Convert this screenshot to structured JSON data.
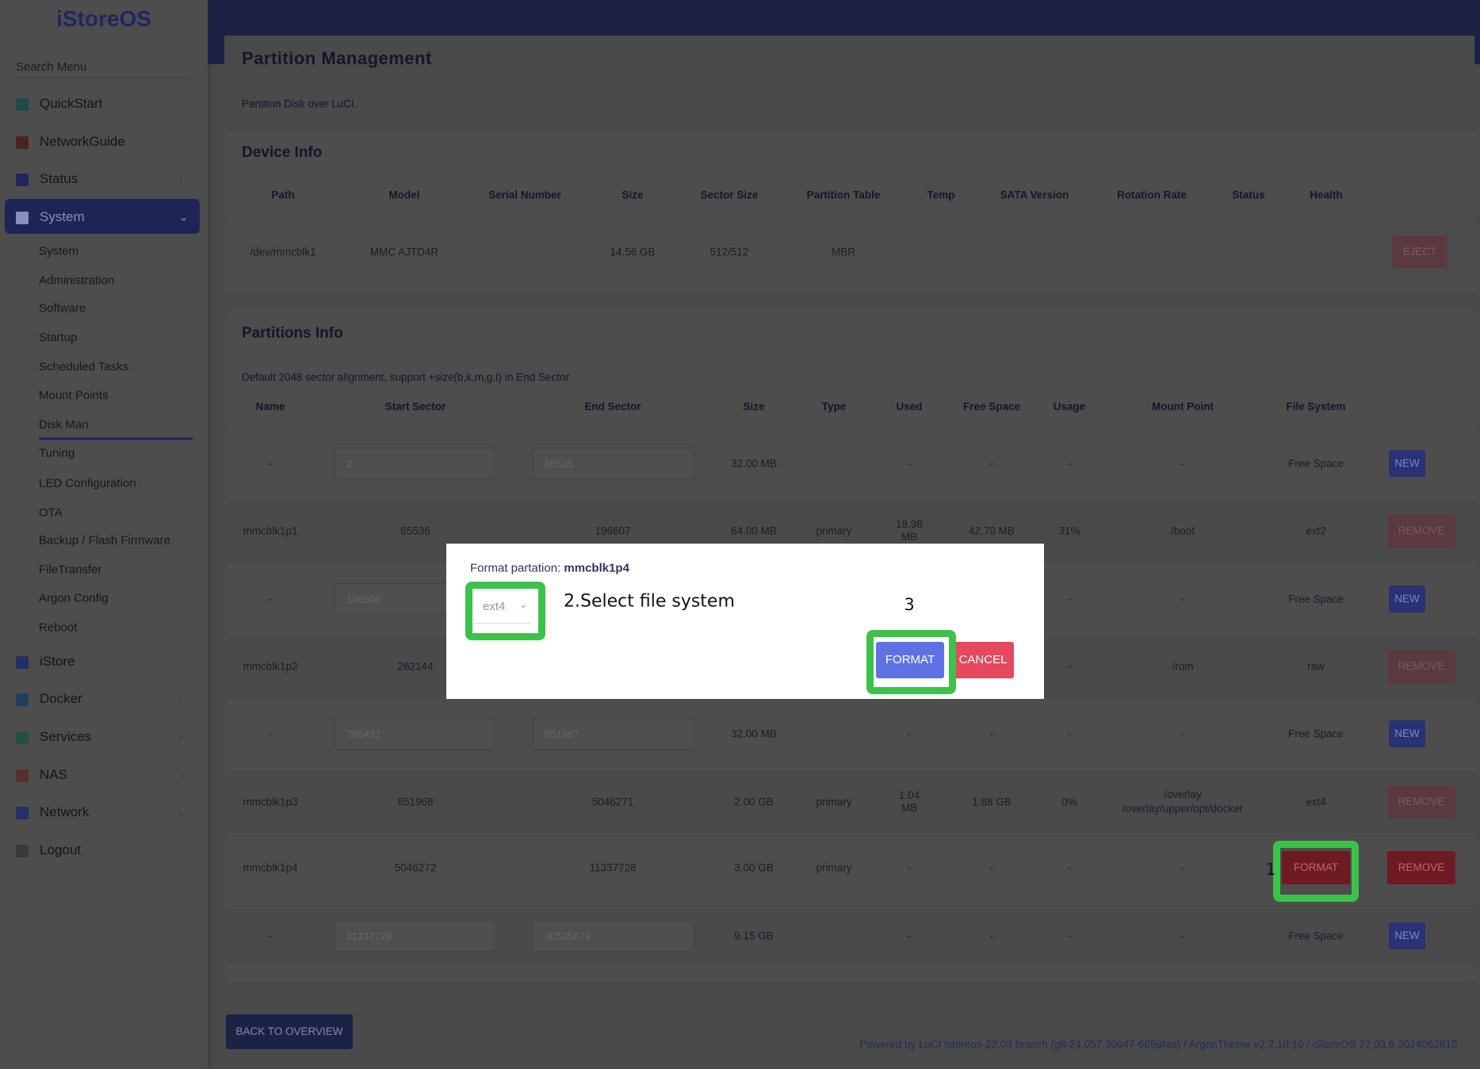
{
  "sidebar": {
    "logo": "iStoreOS",
    "search_placeholder": "Search Menu",
    "items": [
      {
        "label": "QuickStart",
        "icon": "quickstart-icon"
      },
      {
        "label": "NetworkGuide",
        "icon": "globe-icon"
      },
      {
        "label": "Status",
        "icon": "dashboard-icon"
      },
      {
        "label": "System",
        "icon": "gear-icon"
      }
    ],
    "system_sub": [
      "System",
      "Administration",
      "Software",
      "Startup",
      "Scheduled Tasks",
      "Mount Points",
      "Disk Man",
      "Tuning",
      "LED Configuration",
      "OTA",
      "Backup / Flash Firmware",
      "FileTransfer",
      "Argon Config",
      "Reboot"
    ],
    "active_sub": "Disk Man",
    "bottom_items": [
      {
        "label": "iStore",
        "icon": "store-icon"
      },
      {
        "label": "Docker",
        "icon": "docker-icon"
      },
      {
        "label": "Services",
        "icon": "services-icon"
      },
      {
        "label": "NAS",
        "icon": "nas-icon"
      },
      {
        "label": "Network",
        "icon": "network-icon"
      },
      {
        "label": "Logout",
        "icon": "logout-icon"
      }
    ]
  },
  "page": {
    "title": "Partition Management",
    "description": "Partition Disk over LuCI."
  },
  "device_info": {
    "heading": "Device Info",
    "headers": [
      "Path",
      "Model",
      "Serial Number",
      "Size",
      "Sector Size",
      "Partition Table",
      "Temp",
      "SATA Version",
      "Rotation Rate",
      "Status",
      "Health"
    ],
    "row": [
      "/dev/mmcblk1",
      "MMC AJTD4R",
      "",
      "14.56 GB",
      "512/512",
      "MBR",
      "",
      "",
      "",
      "",
      ""
    ],
    "eject_label": "EJECT"
  },
  "partitions": {
    "heading": "Partitions Info",
    "note": "Default 2048 sector alignment, support +size(b,k,m,g,t) in End Sector",
    "headers": [
      "Name",
      "Start Sector",
      "End Sector",
      "Size",
      "Type",
      "Used",
      "Free Space",
      "Usage",
      "Mount Point",
      "File System"
    ],
    "rows": [
      {
        "name": "-",
        "start": "2",
        "end": "65535",
        "size": "32.00 MB",
        "type": "",
        "used": "-",
        "free": "-",
        "usage": "-",
        "mount": "-",
        "fs": "Free Space",
        "action": "NEW",
        "editable": true
      },
      {
        "name": "mmcblk1p1",
        "start": "65536",
        "end": "196607",
        "size": "64.00 MB",
        "type": "primary",
        "used": "18.98 MB",
        "free": "42.70 MB",
        "usage": "31%",
        "mount": "/boot",
        "fs": "ext2",
        "action": "REMOVE"
      },
      {
        "name": "-",
        "start": "196608",
        "end": "",
        "size": "",
        "type": "",
        "used": "",
        "free": "",
        "usage": "-",
        "mount": "-",
        "fs": "Free Space",
        "action": "NEW",
        "editable": true
      },
      {
        "name": "mmcblk1p2",
        "start": "262144",
        "end": "",
        "size": "",
        "type": "",
        "used": "",
        "free": "",
        "usage": "-",
        "mount": "/rom",
        "fs": "raw",
        "action": "REMOVE"
      },
      {
        "name": "-",
        "start": "786432",
        "end": "851967",
        "size": "32.00 MB",
        "type": "",
        "used": "-",
        "free": "-",
        "usage": "-",
        "mount": "-",
        "fs": "Free Space",
        "action": "NEW",
        "editable": true
      },
      {
        "name": "mmcblk1p3",
        "start": "851968",
        "end": "5046271",
        "size": "2.00 GB",
        "type": "primary",
        "used": "1.04 MB",
        "free": "1.88 GB",
        "usage": "0%",
        "mount": "/overlay\n/overlay/upper/opt/docker",
        "fs": "ext4",
        "action": "REMOVE"
      },
      {
        "name": "mmcblk1p4",
        "start": "5046272",
        "end": "11337728",
        "size": "3.00 GB",
        "type": "primary",
        "used": "-",
        "free": "-",
        "usage": "-",
        "mount": "-",
        "fs": "FORMAT",
        "action": "REMOVE",
        "active": true
      },
      {
        "name": "-",
        "start": "11337729",
        "end": "30535679",
        "size": "9.15 GB",
        "type": "",
        "used": "-",
        "free": "-",
        "usage": "-",
        "mount": "-",
        "fs": "Free Space",
        "action": "NEW",
        "editable": true
      }
    ]
  },
  "back_label": "BACK TO OVERVIEW",
  "footer": "Powered by LuCI istoreos-22.03 branch (git-24.057.30647-6659faa) / ArgonTheme v2.2.10.10 / iStoreOS 22.03.6 2024062810",
  "modal": {
    "label": "Format partation: ",
    "partition": "mmcblk1p4",
    "fs_value": "ext4",
    "format_label": "FORMAT",
    "cancel_label": "CANCEL"
  },
  "annotations": {
    "step1": "1",
    "step2": "2.Select file system",
    "step3": "3"
  },
  "colors": {
    "primary": "#5e72e4",
    "danger": "#f5365c",
    "highlight": "#3cc24a"
  }
}
